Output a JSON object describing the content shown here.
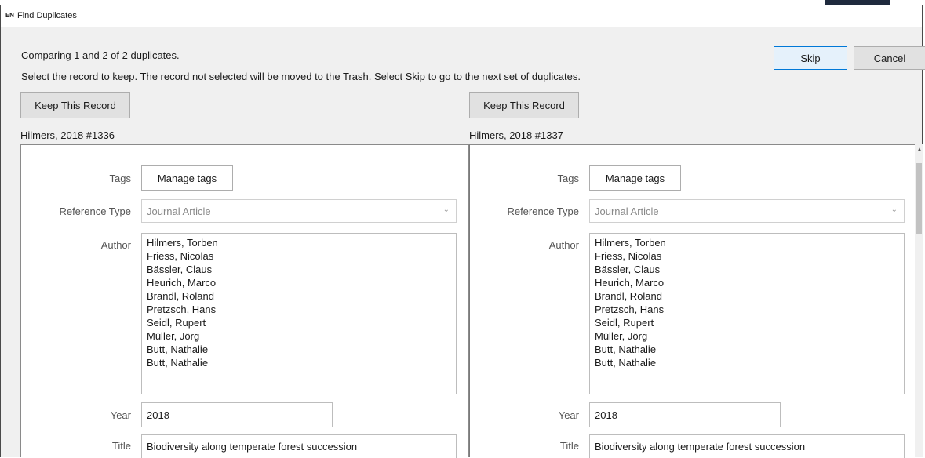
{
  "window": {
    "title": "Find Duplicates",
    "lang_badge": "EN"
  },
  "status_text": "Comparing 1 and 2 of 2 duplicates.",
  "instructions_text": "Select the record to keep. The record not selected will be moved to the Trash. Select Skip to go to the next set of duplicates.",
  "buttons": {
    "skip": "Skip",
    "cancel": "Cancel"
  },
  "records": [
    {
      "keep_label": "Keep This Record",
      "record_id": "Hilmers, 2018 #1336",
      "labels": {
        "tags": "Tags",
        "reference_type": "Reference Type",
        "author": "Author",
        "year": "Year",
        "title": "Title"
      },
      "manage_tags": "Manage tags",
      "reference_type": "Journal Article",
      "authors": [
        "Hilmers, Torben",
        "Friess, Nicolas",
        "Bässler, Claus",
        "Heurich, Marco",
        "Brandl, Roland",
        "Pretzsch, Hans",
        "Seidl, Rupert",
        "Müller, Jörg",
        "Butt, Nathalie",
        "Butt, Nathalie"
      ],
      "year": "2018",
      "title": "Biodiversity along temperate forest succession"
    },
    {
      "keep_label": "Keep This Record",
      "record_id": "Hilmers, 2018 #1337",
      "labels": {
        "tags": "Tags",
        "reference_type": "Reference Type",
        "author": "Author",
        "year": "Year",
        "title": "Title"
      },
      "manage_tags": "Manage tags",
      "reference_type": "Journal Article",
      "authors": [
        "Hilmers, Torben",
        "Friess, Nicolas",
        "Bässler, Claus",
        "Heurich, Marco",
        "Brandl, Roland",
        "Pretzsch, Hans",
        "Seidl, Rupert",
        "Müller, Jörg",
        "Butt, Nathalie",
        "Butt, Nathalie"
      ],
      "year": "2018",
      "title": "Biodiversity along temperate forest succession"
    }
  ]
}
